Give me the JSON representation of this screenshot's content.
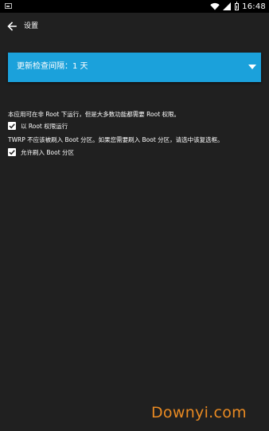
{
  "status_bar": {
    "time": "16:48",
    "icons": [
      "notification-icon",
      "wifi-icon",
      "signal-icon",
      "battery-icon"
    ]
  },
  "toolbar": {
    "back_icon": "back-arrow-icon",
    "title": "设置"
  },
  "update_spinner": {
    "label": "更新检查间隔：1 天",
    "background_color": "#1ba1db"
  },
  "root_section": {
    "description": "本应用可在非 Root 下运行，但是大多数功能都需要 Root 权限。",
    "checkbox_label": "以 Root 权限运行",
    "checked": true
  },
  "boot_section": {
    "description": "TWRP 不应该被刷入 Boot 分区。如果您需要刷入 Boot 分区，请选中该复选框。",
    "checkbox_label": "允许刷入 Boot 分区",
    "checked": true
  },
  "watermark": {
    "text": "Downyi.com"
  }
}
